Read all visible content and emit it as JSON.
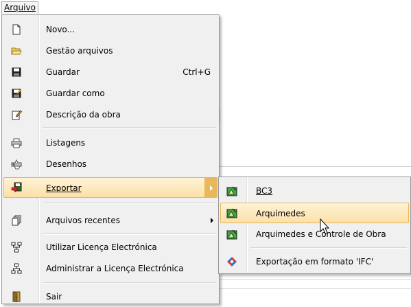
{
  "menubar": {
    "file_menu": "Arquivo"
  },
  "menu": {
    "items": [
      {
        "label": "Novo...",
        "shortcut": "",
        "icon": "new-document-icon"
      },
      {
        "label": "Gestão arquivos",
        "shortcut": "",
        "icon": "open-folder-icon"
      },
      {
        "label": "Guardar",
        "shortcut": "Ctrl+G",
        "icon": "save-icon"
      },
      {
        "label": "Guardar como",
        "shortcut": "",
        "icon": "save-as-icon"
      },
      {
        "label": "Descrição da obra",
        "shortcut": "",
        "icon": "edit-document-icon"
      },
      {
        "label": "Listagens",
        "shortcut": "",
        "icon": "printer-icon"
      },
      {
        "label": "Desenhos",
        "shortcut": "",
        "icon": "plotter-icon"
      },
      {
        "label": "Exportar",
        "shortcut": "",
        "icon": "export-icon"
      },
      {
        "label": "Arquivos recentes",
        "shortcut": "",
        "icon": "recent-files-icon"
      },
      {
        "label": "Utilizar Licença Electrónica",
        "shortcut": "",
        "icon": "network-license-icon"
      },
      {
        "label": "Administrar a Licença Electrónica",
        "shortcut": "",
        "icon": "network-admin-icon"
      },
      {
        "label": "Sair",
        "shortcut": "",
        "icon": "exit-door-icon"
      }
    ]
  },
  "submenu": {
    "items": [
      {
        "label": "BC3",
        "icon": "bc3-export-icon"
      },
      {
        "label": "Arquimedes",
        "icon": "arquimedes-export-icon"
      },
      {
        "label": "Arquimedes e Controle de Obra",
        "icon": "arquimedes-control-icon"
      },
      {
        "label": "Exportação em formato 'IFC'",
        "icon": "ifc-export-icon"
      }
    ]
  },
  "colors": {
    "highlight_top": "#fff3d6",
    "highlight_bottom": "#fce0a8",
    "highlight_border": "#e7b65a",
    "menu_bg": "#f0f0f0"
  }
}
